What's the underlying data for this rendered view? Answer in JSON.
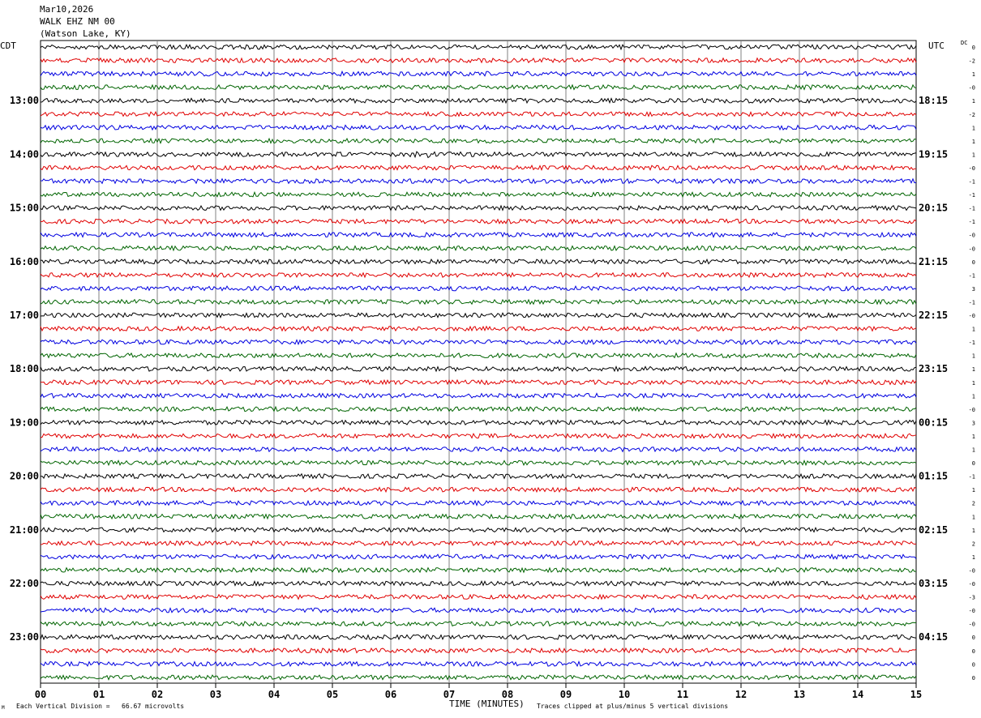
{
  "header": {
    "date": "Mar10,2026",
    "station": "WALK EHZ NM 00",
    "location": "(Watson Lake, KY)"
  },
  "left_axis_label": "CDT",
  "right_axis_label": "UTC",
  "dc_label": "DC",
  "x_axis_title": "TIME (MINUTES)",
  "footer": {
    "corner_mark": "M",
    "scale_note": "Each Vertical Division =   66.67 microvolts",
    "clip_note": "Traces clipped at plus/minus 5 vertical divisions"
  },
  "chart_data": {
    "type": "line",
    "title": "WALK EHZ NM 00 (Watson Lake, KY) Mar10,2026",
    "xlabel": "TIME (MINUTES)",
    "xlim": [
      0,
      15
    ],
    "x_ticks": [
      "00",
      "01",
      "02",
      "03",
      "04",
      "05",
      "06",
      "07",
      "08",
      "09",
      "10",
      "11",
      "12",
      "13",
      "14",
      "15"
    ],
    "rows_per_hour": 4,
    "trace_count": 48,
    "trace_colors": [
      "#000000",
      "#e00000",
      "#0000e0",
      "#006400"
    ],
    "cdt_labels": [
      {
        "row": 4,
        "label": "13:00"
      },
      {
        "row": 8,
        "label": "14:00"
      },
      {
        "row": 12,
        "label": "15:00"
      },
      {
        "row": 16,
        "label": "16:00"
      },
      {
        "row": 20,
        "label": "17:00"
      },
      {
        "row": 24,
        "label": "18:00"
      },
      {
        "row": 28,
        "label": "19:00"
      },
      {
        "row": 32,
        "label": "20:00"
      },
      {
        "row": 36,
        "label": "21:00"
      },
      {
        "row": 40,
        "label": "22:00"
      },
      {
        "row": 44,
        "label": "23:00"
      }
    ],
    "utc_labels": [
      {
        "row": 4,
        "label": "18:15"
      },
      {
        "row": 8,
        "label": "19:15"
      },
      {
        "row": 12,
        "label": "20:15"
      },
      {
        "row": 16,
        "label": "21:15"
      },
      {
        "row": 20,
        "label": "22:15"
      },
      {
        "row": 24,
        "label": "23:15"
      },
      {
        "row": 28,
        "label": "00:15"
      },
      {
        "row": 32,
        "label": "01:15"
      },
      {
        "row": 36,
        "label": "02:15"
      },
      {
        "row": 40,
        "label": "03:15"
      },
      {
        "row": 44,
        "label": "04:15"
      }
    ],
    "dc_offsets": [
      "0",
      "-2",
      "1",
      "-0",
      "1",
      "-2",
      "1",
      "1",
      "1",
      "-0",
      "-1",
      "-1",
      "-1",
      "-1",
      "-0",
      "-0",
      "0",
      "-1",
      "3",
      "-1",
      "-0",
      "1",
      "-1",
      "1",
      "1",
      "1",
      "1",
      "-0",
      "3",
      "1",
      "1",
      "0",
      "-1",
      "1",
      "2",
      "1",
      "1",
      "2",
      "1",
      "-0",
      "-0",
      "-3",
      "-0",
      "-0",
      "0",
      "0",
      "0",
      "0"
    ],
    "amplitude_divisions": 0.8,
    "events": [
      {
        "row": 8,
        "minute": 6.6,
        "amplitude_divisions": 1.4
      }
    ]
  }
}
